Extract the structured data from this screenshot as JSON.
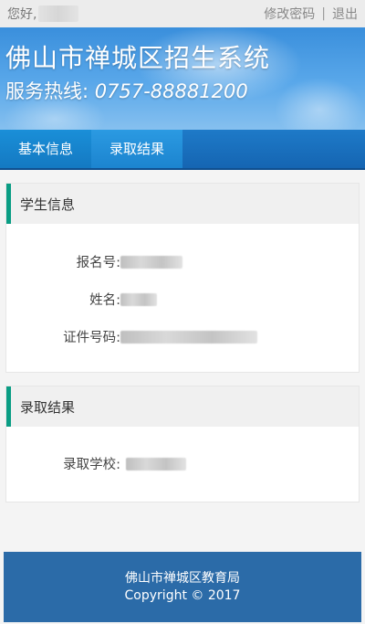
{
  "topbar": {
    "greeting": "您好,",
    "change_password": "修改密码",
    "separator": "|",
    "logout": "退出"
  },
  "banner": {
    "title": "佛山市禅城区招生系统",
    "hotline_label": "服务热线:",
    "hotline_number": "0757-88881200"
  },
  "nav": {
    "tabs": [
      {
        "label": "基本信息"
      },
      {
        "label": "录取结果"
      }
    ]
  },
  "student_card": {
    "title": "学生信息",
    "fields": [
      {
        "label": "报名号:"
      },
      {
        "label": "姓名:"
      },
      {
        "label": "证件号码:"
      }
    ]
  },
  "result_card": {
    "title": "录取结果",
    "fields": [
      {
        "label": "录取学校:"
      }
    ]
  },
  "footer": {
    "org": "佛山市禅城区教育局",
    "copyright": "Copyright © 2017"
  },
  "colors": {
    "accent": "#0a9d84",
    "nav_blue": "#1565b2",
    "footer_blue": "#2b6ba8"
  }
}
